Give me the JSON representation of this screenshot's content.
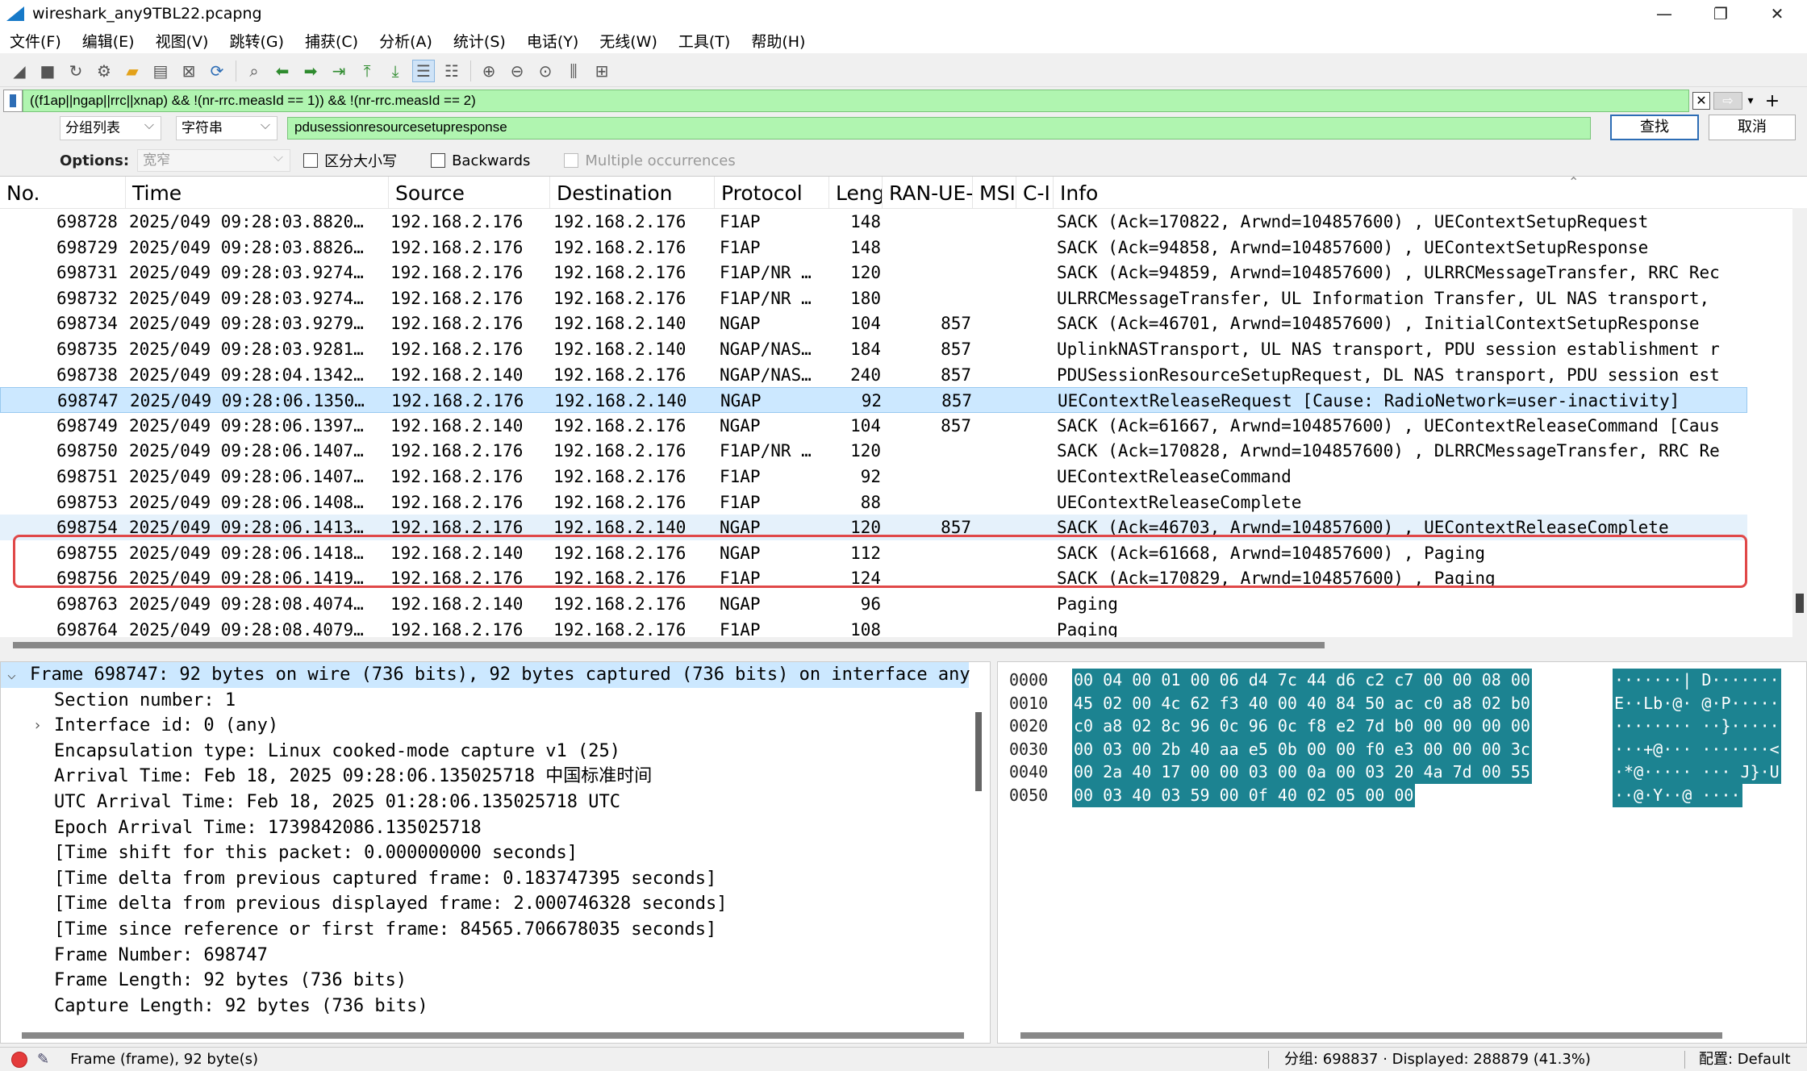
{
  "window": {
    "title": "wireshark_any9TBL22.pcapng",
    "minimize": "—",
    "restore": "❐",
    "close": "✕"
  },
  "menu": [
    "文件(F)",
    "编辑(E)",
    "视图(V)",
    "跳转(G)",
    "捕获(C)",
    "分析(A)",
    "统计(S)",
    "电话(Y)",
    "无线(W)",
    "工具(T)",
    "帮助(H)"
  ],
  "filter": {
    "value": "((f1ap||ngap||rrc||xnap) && !(nr-rrc.measId == 1)) && !(nr-rrc.measId == 2)",
    "clear": "✕",
    "apply": "⇨",
    "dropdown": "▾",
    "add": "+"
  },
  "find": {
    "scope": "分组列表",
    "type": "字符串",
    "value": "pdusessionresourcesetupresponse",
    "find_button": "查找",
    "cancel_button": "取消"
  },
  "options": {
    "label": "Options:",
    "charset": "宽窄",
    "case": "区分大小写",
    "backwards": "Backwards",
    "multiple": "Multiple occurrences"
  },
  "columns": [
    "No.",
    "Time",
    "Source",
    "Destination",
    "Protocol",
    "Leng",
    "RAN-UE-",
    "MSI",
    "C-I",
    "Info"
  ],
  "packets": [
    {
      "no": "698728",
      "time": "2025/049 09:28:03.8820…",
      "src": "192.168.2.176",
      "dst": "192.168.2.176",
      "proto": "F1AP",
      "len": "148",
      "ranue": "",
      "info": "SACK (Ack=170822, Arwnd=104857600) , UEContextSetupRequest"
    },
    {
      "no": "698729",
      "time": "2025/049 09:28:03.8826…",
      "src": "192.168.2.176",
      "dst": "192.168.2.176",
      "proto": "F1AP",
      "len": "148",
      "ranue": "",
      "info": "SACK (Ack=94858, Arwnd=104857600) , UEContextSetupResponse"
    },
    {
      "no": "698731",
      "time": "2025/049 09:28:03.9274…",
      "src": "192.168.2.176",
      "dst": "192.168.2.176",
      "proto": "F1AP/NR …",
      "len": "120",
      "ranue": "",
      "info": "SACK (Ack=94859, Arwnd=104857600) , ULRRCMessageTransfer, RRC Rec"
    },
    {
      "no": "698732",
      "time": "2025/049 09:28:03.9274…",
      "src": "192.168.2.176",
      "dst": "192.168.2.176",
      "proto": "F1AP/NR …",
      "len": "180",
      "ranue": "",
      "info": "ULRRCMessageTransfer, UL Information Transfer, UL NAS transport,"
    },
    {
      "no": "698734",
      "time": "2025/049 09:28:03.9279…",
      "src": "192.168.2.176",
      "dst": "192.168.2.140",
      "proto": "NGAP",
      "len": "104",
      "ranue": "857",
      "info": "SACK (Ack=46701, Arwnd=104857600) , InitialContextSetupResponse"
    },
    {
      "no": "698735",
      "time": "2025/049 09:28:03.9281…",
      "src": "192.168.2.176",
      "dst": "192.168.2.140",
      "proto": "NGAP/NAS…",
      "len": "184",
      "ranue": "857",
      "info": "UplinkNASTransport, UL NAS transport, PDU session establishment r"
    },
    {
      "no": "698738",
      "time": "2025/049 09:28:04.1342…",
      "src": "192.168.2.140",
      "dst": "192.168.2.176",
      "proto": "NGAP/NAS…",
      "len": "240",
      "ranue": "857",
      "info": "PDUSessionResourceSetupRequest, DL NAS transport, PDU session est"
    },
    {
      "no": "698747",
      "time": "2025/049 09:28:06.1350…",
      "src": "192.168.2.176",
      "dst": "192.168.2.140",
      "proto": "NGAP",
      "len": "92",
      "ranue": "857",
      "info": "UEContextReleaseRequest [Cause: RadioNetwork=user-inactivity]"
    },
    {
      "no": "698749",
      "time": "2025/049 09:28:06.1397…",
      "src": "192.168.2.140",
      "dst": "192.168.2.176",
      "proto": "NGAP",
      "len": "104",
      "ranue": "857",
      "info": "SACK (Ack=61667, Arwnd=104857600) , UEContextReleaseCommand [Caus"
    },
    {
      "no": "698750",
      "time": "2025/049 09:28:06.1407…",
      "src": "192.168.2.176",
      "dst": "192.168.2.176",
      "proto": "F1AP/NR …",
      "len": "120",
      "ranue": "",
      "info": "SACK (Ack=170828, Arwnd=104857600) , DLRRCMessageTransfer, RRC Re"
    },
    {
      "no": "698751",
      "time": "2025/049 09:28:06.1407…",
      "src": "192.168.2.176",
      "dst": "192.168.2.176",
      "proto": "F1AP",
      "len": "92",
      "ranue": "",
      "info": "UEContextReleaseCommand"
    },
    {
      "no": "698753",
      "time": "2025/049 09:28:06.1408…",
      "src": "192.168.2.176",
      "dst": "192.168.2.176",
      "proto": "F1AP",
      "len": "88",
      "ranue": "",
      "info": "UEContextReleaseComplete"
    },
    {
      "no": "698754",
      "time": "2025/049 09:28:06.1413…",
      "src": "192.168.2.176",
      "dst": "192.168.2.140",
      "proto": "NGAP",
      "len": "120",
      "ranue": "857",
      "info": "SACK (Ack=46703, Arwnd=104857600) , UEContextReleaseComplete"
    },
    {
      "no": "698755",
      "time": "2025/049 09:28:06.1418…",
      "src": "192.168.2.140",
      "dst": "192.168.2.176",
      "proto": "NGAP",
      "len": "112",
      "ranue": "",
      "info": "SACK (Ack=61668, Arwnd=104857600) , Paging"
    },
    {
      "no": "698756",
      "time": "2025/049 09:28:06.1419…",
      "src": "192.168.2.176",
      "dst": "192.168.2.176",
      "proto": "F1AP",
      "len": "124",
      "ranue": "",
      "info": "SACK (Ack=170829, Arwnd=104857600) , Paging"
    },
    {
      "no": "698763",
      "time": "2025/049 09:28:08.4074…",
      "src": "192.168.2.140",
      "dst": "192.168.2.176",
      "proto": "NGAP",
      "len": "96",
      "ranue": "",
      "info": "Paging"
    },
    {
      "no": "698764",
      "time": "2025/049 09:28:08.4079…",
      "src": "192.168.2.176",
      "dst": "192.168.2.176",
      "proto": "F1AP",
      "len": "108",
      "ranue": "",
      "info": "Paging"
    }
  ],
  "details": [
    {
      "text": "Frame 698747: 92 bytes on wire (736 bits), 92 bytes captured (736 bits) on interface any",
      "arrow": "⌵"
    },
    {
      "text": "Section number: 1",
      "arrow": ""
    },
    {
      "text": "Interface id: 0 (any)",
      "arrow": "›"
    },
    {
      "text": "Encapsulation type: Linux cooked-mode capture v1 (25)",
      "arrow": ""
    },
    {
      "text": "Arrival Time: Feb 18, 2025 09:28:06.135025718 中国标准时间",
      "arrow": ""
    },
    {
      "text": "UTC Arrival Time: Feb 18, 2025 01:28:06.135025718 UTC",
      "arrow": ""
    },
    {
      "text": "Epoch Arrival Time: 1739842086.135025718",
      "arrow": ""
    },
    {
      "text": "[Time shift for this packet: 0.000000000 seconds]",
      "arrow": ""
    },
    {
      "text": "[Time delta from previous captured frame: 0.183747395 seconds]",
      "arrow": ""
    },
    {
      "text": "[Time delta from previous displayed frame: 2.000746328 seconds]",
      "arrow": ""
    },
    {
      "text": "[Time since reference or first frame: 84565.706678035 seconds]",
      "arrow": ""
    },
    {
      "text": "Frame Number: 698747",
      "arrow": ""
    },
    {
      "text": "Frame Length: 92 bytes (736 bits)",
      "arrow": ""
    },
    {
      "text": "Capture Length: 92 bytes (736 bits)",
      "arrow": ""
    }
  ],
  "bytes": [
    {
      "off": "0000",
      "hex": "00 04 00 01 00 06 d4 7c  44 d6 c2 c7 00 00 08 00",
      "asc": "·······| D·······"
    },
    {
      "off": "0010",
      "hex": "45 02 00 4c 62 f3 40 00  40 84 50 ac c0 a8 02 b0",
      "asc": "E··Lb·@· @·P·····"
    },
    {
      "off": "0020",
      "hex": "c0 a8 02 8c 96 0c 96 0c  f8 e2 7d b0 00 00 00 00",
      "asc": "········ ··}·····"
    },
    {
      "off": "0030",
      "hex": "00 03 00 2b 40 aa e5 0b  00 00 f0 e3 00 00 00 3c",
      "asc": "···+@··· ·······<"
    },
    {
      "off": "0040",
      "hex": "00 2a 40 17 00 00 03 00  0a 00 03 20 4a 7d 00 55",
      "asc": "·*@····· ··· J}·U"
    },
    {
      "off": "0050",
      "hex": "00 03 40 03 59 00 0f 40  02 05 00 00",
      "asc": "··@·Y··@ ····"
    }
  ],
  "status": {
    "left": "Frame (frame), 92 byte(s)",
    "counts": "分组: 698837 · Displayed: 288879 (41.3%)",
    "profile": "配置:  Default",
    "edit": "✎"
  },
  "colors": {
    "filter_green": "#b0f5b0",
    "selection": "#cce8ff",
    "hover": "#e5f1fb",
    "bytes_hl": "#1c8391",
    "red_box": "#e04848"
  }
}
